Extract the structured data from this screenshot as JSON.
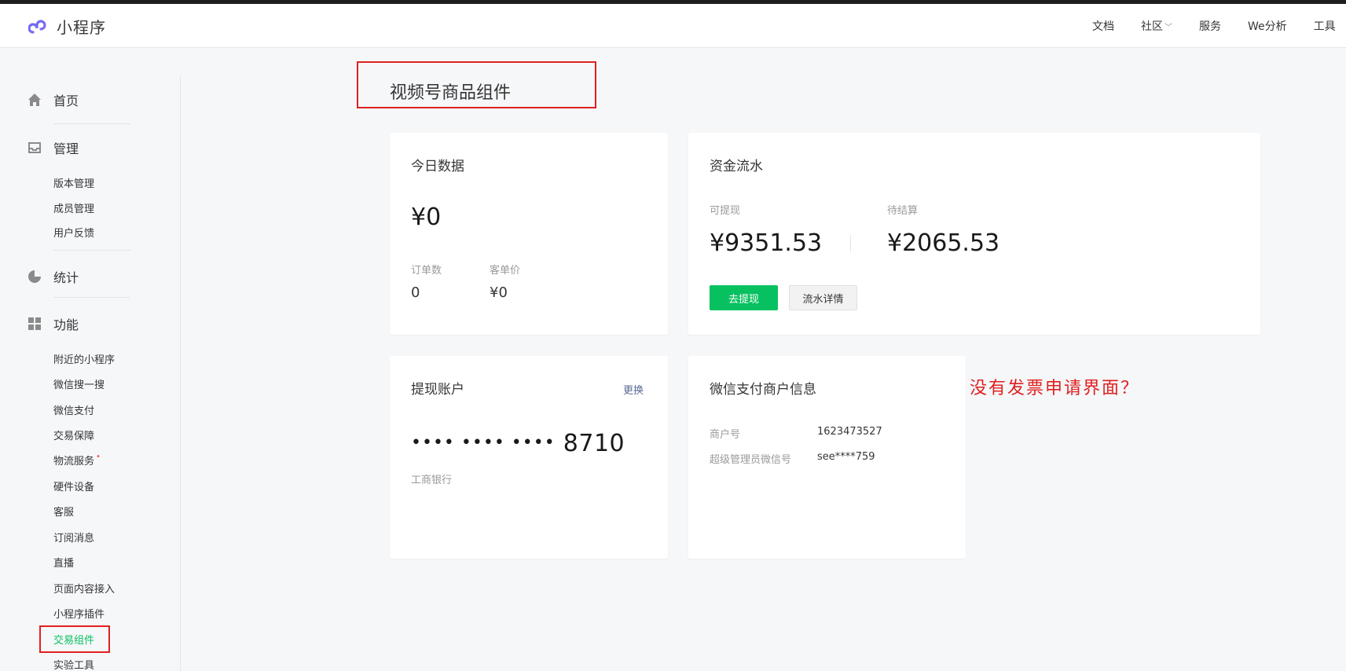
{
  "header": {
    "logo_text": "小程序",
    "nav": [
      "文档",
      "社区",
      "服务",
      "We分析",
      "工具"
    ]
  },
  "sidebar": {
    "home": "首页",
    "manage": {
      "label": "管理",
      "items": [
        "版本管理",
        "成员管理",
        "用户反馈"
      ]
    },
    "stats": "统计",
    "features": {
      "label": "功能",
      "items": [
        "附近的小程序",
        "微信搜一搜",
        "微信支付",
        "交易保障",
        "物流服务",
        "硬件设备",
        "客服",
        "订阅消息",
        "直播",
        "页面内容接入",
        "小程序插件",
        "交易组件",
        "实验工具"
      ],
      "badge_dot": "•"
    }
  },
  "page": {
    "title": "视频号商品组件"
  },
  "today": {
    "title": "今日数据",
    "amount": "¥0",
    "orders_label": "订单数",
    "orders_value": "0",
    "avg_label": "客单价",
    "avg_value": "¥0"
  },
  "funds": {
    "title": "资金流水",
    "withdrawable_label": "可提现",
    "withdrawable_value": "¥9351.53",
    "pending_label": "待结算",
    "pending_value": "¥2065.53",
    "withdraw_button": "去提现",
    "details_button": "流水详情"
  },
  "account": {
    "title": "提现账户",
    "change_link": "更换",
    "masked_dots": "•••• •••• ••••",
    "last_digits": "8710",
    "bank": "工商银行"
  },
  "merchant": {
    "title": "微信支付商户信息",
    "rows": [
      {
        "label": "商户号",
        "value": "1623473527"
      },
      {
        "label": "超级管理员微信号",
        "value": "see****759"
      }
    ]
  },
  "annotation": "没有发票申请界面？",
  "colors": {
    "accent": "#07c160",
    "annotation": "#e02020",
    "link": "#576b95"
  }
}
